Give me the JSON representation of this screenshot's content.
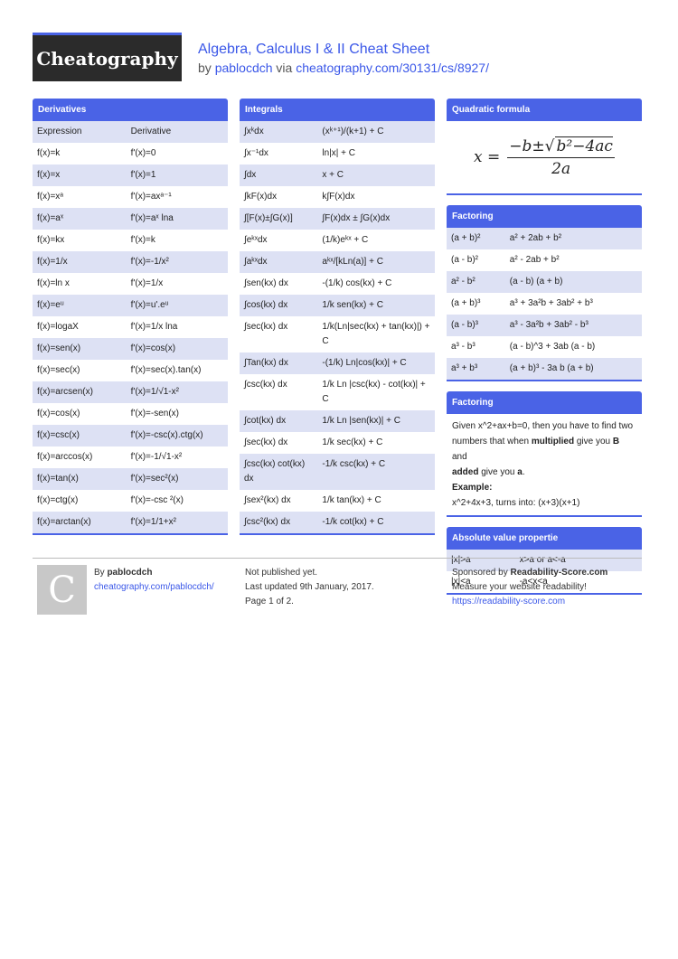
{
  "header": {
    "logo_text": "Cheatography",
    "title": "Algebra, Calculus I & II Cheat Sheet",
    "by": "by",
    "author": "pablocdch",
    "via": "via",
    "url": "cheatography.com/30131/cs/8927/"
  },
  "derivatives": {
    "title": "Derivatives",
    "rows": [
      [
        "Expression",
        "Derivative"
      ],
      [
        "f(x)=k",
        "f'(x)=0"
      ],
      [
        "f(x)=x",
        "f'(x)=1"
      ],
      [
        "f(x)=xᵃ",
        "f'(x)=axᵃ⁻¹"
      ],
      [
        "f(x)=aˣ",
        "f'(x)=aˣ lna"
      ],
      [
        "f(x)=kx",
        "f'(x)=k"
      ],
      [
        "f(x)=1/x",
        "f'(x)=-1/x²"
      ],
      [
        "f(x)=ln x",
        "f'(x)=1/x"
      ],
      [
        "f(x)=eᵘ",
        "f'(x)=u'.eᵘ"
      ],
      [
        "f(x)=logaX",
        "f'(x)=1/x lna"
      ],
      [
        "f(x)=sen(x)",
        "f'(x)=cos(x)"
      ],
      [
        "f(x)=sec(x)",
        "f'(x)=sec(x).tan(x)"
      ],
      [
        "f(x)=arcsen(x)",
        "f'(x)=1/√1-x²"
      ],
      [
        "f(x)=cos(x)",
        "f'(x)=-sen(x)"
      ],
      [
        "f(x)=csc(x)",
        "f'(x)=-csc(x).ctg(x)"
      ],
      [
        "f(x)=arccos(x)",
        "f'(x)=-1/√1-x²"
      ],
      [
        "f(x)=tan(x)",
        "f'(x)=sec²(x)"
      ],
      [
        "f(x)=ctg(x)",
        "f'(x)=-csc ²(x)"
      ],
      [
        "f(x)=arctan(x)",
        "f'(x)=1/1+x²"
      ]
    ]
  },
  "integrals": {
    "title": "Integrals",
    "rows": [
      [
        "∫xᵏdx",
        "(xᵏ⁺¹)/(k+1) + C"
      ],
      [
        "∫x⁻¹dx",
        "ln|x| + C"
      ],
      [
        "∫dx",
        "x + C"
      ],
      [
        "∫kF(x)dx",
        "k∫F(x)dx"
      ],
      [
        "∫[F(x)±∫G(x)]",
        "∫F(x)dx ± ∫G(x)dx"
      ],
      [
        "∫eᵏˣdx",
        "(1/k)eᵏˣ + C"
      ],
      [
        "∫aᵏˣdx",
        "aᵏˣ/[kLn(a)] + C"
      ],
      [
        "∫sen(kx) dx",
        "-(1/k) cos(kx) + C"
      ],
      [
        "∫cos(kx) dx",
        "1/k sen(kx) + C"
      ],
      [
        "∫sec(kx) dx",
        "1/k(Ln|sec(kx) + tan(kx)|) + C"
      ],
      [
        "∫Tan(kx) dx",
        "-(1/k) Ln|cos(kx)| + C"
      ],
      [
        "∫csc(kx) dx",
        "1/k Ln |csc(kx) - cot(kx)| + C"
      ],
      [
        "∫cot(kx) dx",
        "1/k Ln |sen(kx)| + C"
      ],
      [
        "∫sec(kx) dx",
        "1/k sec(kx) + C"
      ],
      [
        "∫csc(kx) cot(kx) dx",
        "-1/k csc(kx) + C"
      ],
      [
        "∫sex²(kx) dx",
        "1/k tan(kx) + C"
      ],
      [
        "∫csc²(kx) dx",
        "-1/k cot(kx) + C"
      ]
    ]
  },
  "quadratic": {
    "title": "Quadratic formula",
    "lhs": "x =",
    "numerator_prefix": "−b±",
    "radicand": "b²−4ac",
    "denominator": "2a"
  },
  "factoring_table": {
    "title": "Factoring",
    "rows": [
      [
        "(a + b)²",
        "a² + 2ab + b²"
      ],
      [
        "(a - b)²",
        "a² - 2ab + b²"
      ],
      [
        "a² - b²",
        "(a - b) (a + b)"
      ],
      [
        "(a + b)³",
        "a³ + 3a²b + 3ab² + b³"
      ],
      [
        "(a - b)³",
        "a³ - 3a²b + 3ab² - b³"
      ],
      [
        "a³ - b³",
        "(a - b)^3 + 3ab (a - b)"
      ],
      [
        "a³ + b³",
        "(a + b)³ - 3a b (a + b)"
      ]
    ]
  },
  "factoring_text": {
    "title": "Factoring",
    "p1": "Given x^2+ax+b=0, then you have to find two numbers that when",
    "bold1": "multiplied",
    "p2": "give you",
    "bold2": "B",
    "p3": "and",
    "bold3": "added",
    "p4": "give you",
    "bold4": "a",
    "p5": ".",
    "example_label": "Example:",
    "example_text": "x^2+4x+3, turns into: (x+3)(x+1)"
  },
  "absolute": {
    "title": "Absolute value propertie",
    "rows": [
      [
        "|x|>a",
        "x>a or a<-a"
      ],
      [
        "|x|<a",
        "-a<x<a"
      ]
    ]
  },
  "footer": {
    "avatar_letter": "C",
    "by": "By",
    "author": "pablocdch",
    "author_url": "cheatography.com/pablocdch/",
    "status": "Not published yet.",
    "updated": "Last updated 9th January, 2017.",
    "page": "Page 1 of 2.",
    "sponsored_prefix": "Sponsored by",
    "sponsor": "Readability-Score.com",
    "tagline": "Measure your website readability!",
    "sponsor_url": "https://readability-score.com"
  }
}
